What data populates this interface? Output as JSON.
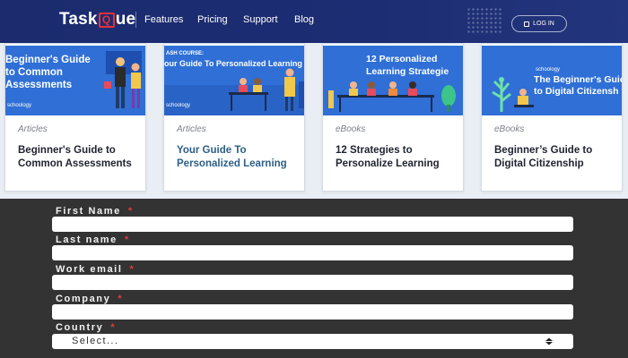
{
  "nav": {
    "logo_text_1": "Task",
    "logo_q": "Q",
    "logo_text_2": "ue",
    "links": [
      "Features",
      "Pricing",
      "Support",
      "Blog"
    ],
    "login": "LOG IN"
  },
  "cards": [
    {
      "image_lines": [
        "Beginner's Guide",
        "to Common",
        "Assessments"
      ],
      "image_brand": "schoology",
      "category": "Articles",
      "title": "Beginner's Guide to Common Assessments",
      "title_link": false
    },
    {
      "image_kicker": "ASH COURSE:",
      "image_lines": [
        "our Guide To Personalized Learning"
      ],
      "image_brand": "schoology",
      "category": "Articles",
      "title": "Your Guide To Personalized Learning",
      "title_link": true
    },
    {
      "image_lines": [
        "12 Personalized",
        "Learning Strategie"
      ],
      "category": "eBooks",
      "title": "12 Strategies to Personalize Learning",
      "title_link": false
    },
    {
      "image_brand": "schoology",
      "image_lines": [
        "The Beginner's Guid",
        "to Digital Citizensh"
      ],
      "category": "eBooks",
      "title": "Beginner’s Guide to Digital Citizenship",
      "title_link": false
    }
  ],
  "form": {
    "fields": [
      {
        "label": "First Name",
        "required": "*"
      },
      {
        "label": "Last name",
        "required": "*"
      },
      {
        "label": "Work email",
        "required": "*"
      },
      {
        "label": "Company",
        "required": "*"
      },
      {
        "label": "Country",
        "required": "*"
      }
    ],
    "country_value": "Select..."
  },
  "colors": {
    "nav_bg": "#1b2b6e",
    "card_image_bg": "#2f6fd6",
    "form_bg": "#333333",
    "required": "#e23b3b",
    "logo_accent": "#e6303a"
  }
}
